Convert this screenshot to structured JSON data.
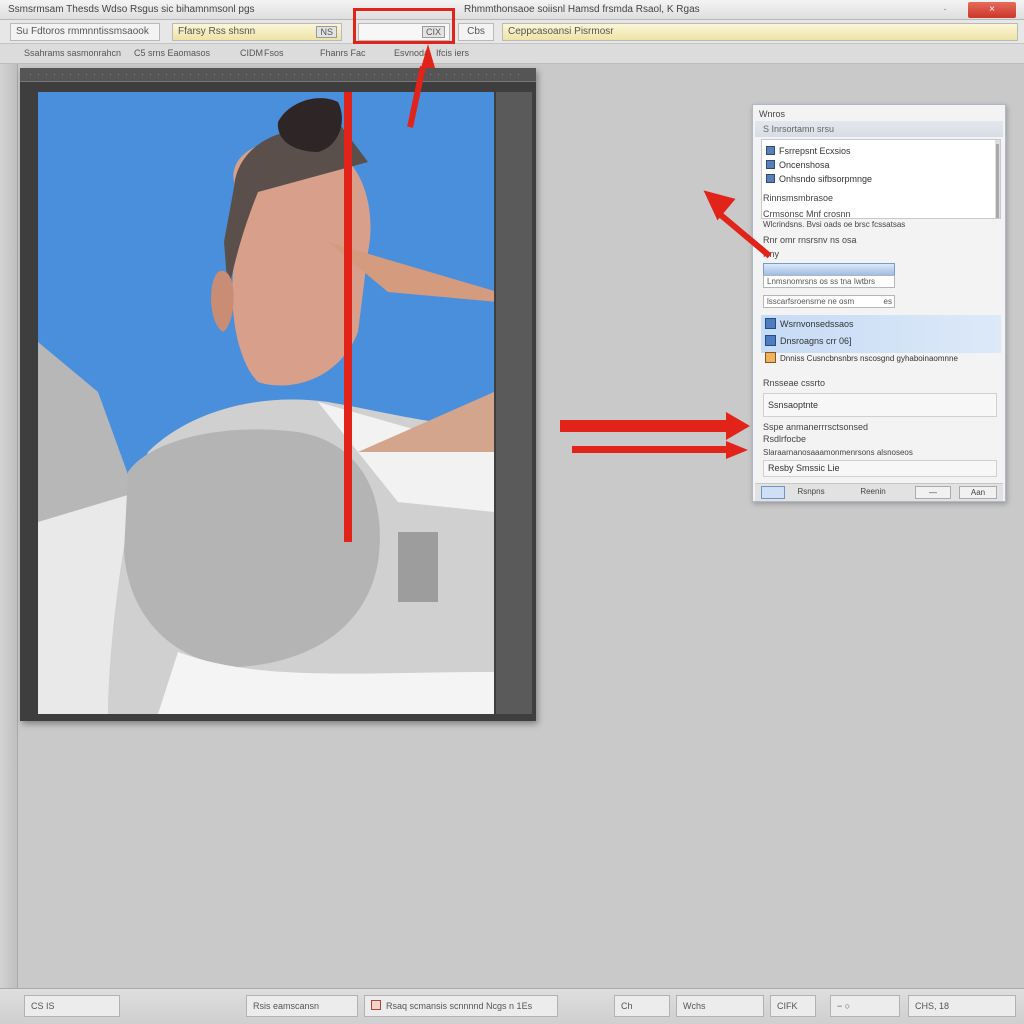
{
  "window": {
    "title_left": "Ssmsrmsam Thesds Wdso Rsgus sic bihamnmsonl pgs",
    "title_right": "Rhmmthonsaoe soiisnl Hamsd frsmda Rsaol, K Rgas",
    "minimize": "·",
    "close": "×"
  },
  "toolbar": {
    "field_1": "Su Fdtoros rmmnntissmsaook",
    "field_2": "Ffarsy Rss shsnn",
    "field_2_button": "NS",
    "field_3_button": "CIX",
    "field_4": "Cbs",
    "field_5": "Ceppcasoansi Pisrmosr"
  },
  "toolbar2": {
    "item_1": "Ssahrams sasmonrahcn",
    "item_2": "C5 srns Eaomasos",
    "item_3": "CIDM",
    "item_4": "Fsos",
    "item_5": "Fhanrs Fac",
    "item_6": "Esvnoda",
    "item_7": "Ifcis iers"
  },
  "panel": {
    "title": "Wnros",
    "subheader": "S Inrsortamn srsu",
    "list": [
      "Fsrrepsnt Ecxsios",
      "Oncenshosa",
      "Onhsndo sifbsorpmnge"
    ],
    "section_1": "Rinnsmsmbrasoe",
    "option_1": "Crmsonsc Mnf crosnn",
    "option_2": "Wlcrindsns. Bvsi oads oe brsc fcssatsas",
    "section_2": "Rnr omr rnsrsnv ns osa",
    "label_1": "Rny",
    "field_1": "Lnmsnomrsns os ss tna Iwtbrs",
    "field_2": "lsscarfsroensrne ne osm",
    "field_2_value": "es",
    "sel_1": "Wsrnvonsedssaos",
    "sel_2": "Dnsroagns crr 06]",
    "row_3": "Dnniss Cusncbnsnbrs nscosgnd gyhaboinaomnne",
    "section_3": "Rnsseae cssrto",
    "box_1": "Ssnsaoptnte",
    "heading": "Sspe anmanerrrsctsonsed",
    "sub_heading": "Rsdlrfocbe",
    "long_line": "Slaraarnanosaaamonmenrsons alsnoseos",
    "combo": "Resby Smssic Lie",
    "foot_1": "Rsnpns",
    "foot_2": "Reenin",
    "foot_3": "—",
    "foot_4": "Aan"
  },
  "statusbar": {
    "item_1": "CS IS",
    "item_2": "Rsis eamscansn",
    "item_3": "Rsaq scmansis scnnnnd Ncgs n 1Es",
    "item_4": "Ch",
    "item_5": "Wchs",
    "item_6": "CIFK",
    "item_7": "− ○",
    "item_8": "CHS, 18"
  },
  "colors": {
    "annotation_red": "#e2231a",
    "canvas_blue": "#4a8fdc",
    "panel_highlight": "#c6dbf6"
  }
}
